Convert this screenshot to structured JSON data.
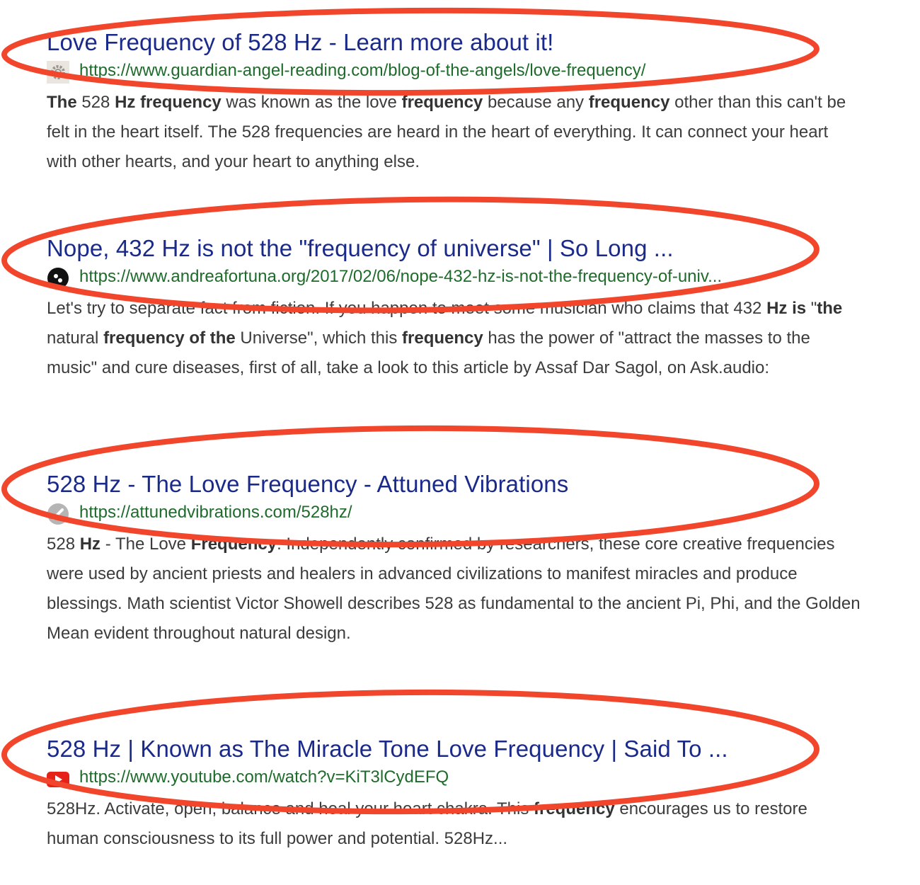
{
  "results": [
    {
      "title": "Love Frequency of 528 Hz - Learn more about it!",
      "url": "https://www.guardian-angel-reading.com/blog-of-the-angels/love-frequency/",
      "favicon": "gear-icon",
      "snippet": [
        {
          "t": "The",
          "b": true
        },
        {
          "t": " 528 ",
          "b": false
        },
        {
          "t": "Hz frequency",
          "b": true
        },
        {
          "t": " was known as the love ",
          "b": false
        },
        {
          "t": "frequency",
          "b": true
        },
        {
          "t": " because any ",
          "b": false
        },
        {
          "t": "frequency",
          "b": true
        },
        {
          "t": " other than this can't be felt in the heart itself. The 528 frequencies are heard in the heart of everything. It can connect your heart with other hearts, and your heart to anything else.",
          "b": false
        }
      ]
    },
    {
      "title": "Nope, 432 Hz is not the \"frequency of universe\" | So Long ...",
      "url": "https://www.andreafortuna.org/2017/02/06/nope-432-hz-is-not-the-frequency-of-univ...",
      "favicon": "black-circle-icon",
      "snippet": [
        {
          "t": "Let's try to separate fact from fiction. If you happen to meet some musician who claims that 432 ",
          "b": false
        },
        {
          "t": "Hz is",
          "b": true
        },
        {
          "t": " \"",
          "b": false
        },
        {
          "t": "the",
          "b": true
        },
        {
          "t": " natural ",
          "b": false
        },
        {
          "t": "frequency of the",
          "b": true
        },
        {
          "t": " Universe\", which this ",
          "b": false
        },
        {
          "t": "frequency",
          "b": true
        },
        {
          "t": " has the power of \"attract the masses to the music\" and cure diseases, first of all, take a look to this article by Assaf Dar Sagol, on Ask.audio:",
          "b": false
        }
      ]
    },
    {
      "title": "528 Hz - The Love Frequency - Attuned Vibrations",
      "url": "https://attunedvibrations.com/528hz/",
      "favicon": "link-icon",
      "snippet": [
        {
          "t": "528 ",
          "b": false
        },
        {
          "t": "Hz",
          "b": true
        },
        {
          "t": " - The Love ",
          "b": false
        },
        {
          "t": "Frequency",
          "b": true
        },
        {
          "t": ". Independently confirmed by researchers, these core creative frequencies were used by ancient priests and healers in advanced civilizations to manifest miracles and produce blessings. Math scientist Victor Showell describes 528 as fundamental to the ancient Pi, Phi, and the Golden Mean evident throughout natural design.",
          "b": false
        }
      ]
    },
    {
      "title": "528 Hz | Known as The Miracle Tone Love Frequency | Said To ...",
      "url": "https://www.youtube.com/watch?v=KiT3lCydEFQ",
      "favicon": "youtube-icon",
      "snippet": [
        {
          "t": "528Hz. Activate, open, balance and heal your heart chakra. This ",
          "b": false
        },
        {
          "t": "frequency",
          "b": true
        },
        {
          "t": " encourages us to restore human consciousness to its full power and potential. 528Hz...",
          "b": false
        }
      ]
    }
  ],
  "colors": {
    "title": "#1a2a8a",
    "url": "#1e6b2b",
    "snippet": "#3c3c3c",
    "annotation": "#f2462c"
  }
}
